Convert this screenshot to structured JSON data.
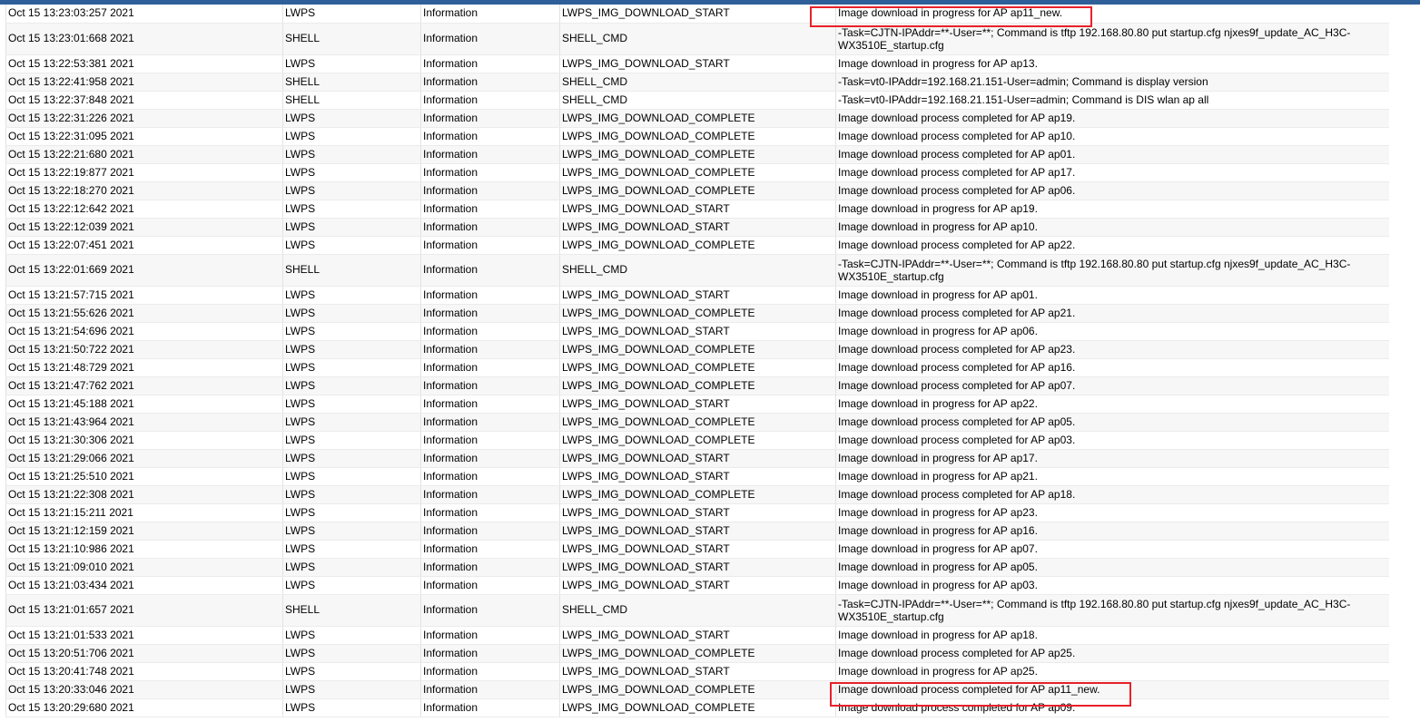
{
  "colors": {
    "top_bar": "#2f5f98",
    "highlight_border": "#e8212a",
    "row_alt": "#f7f7f7",
    "grid": "#e2e2e2"
  },
  "log": {
    "rows": [
      {
        "time": "Oct 15 13:23:03:257 2021",
        "module": "LWPS",
        "level": "Information",
        "mnemonic": "LWPS_IMG_DOWNLOAD_START",
        "message": "Image download in progress for AP ap11_new."
      },
      {
        "time": "Oct 15 13:23:01:668 2021",
        "module": "SHELL",
        "level": "Information",
        "mnemonic": "SHELL_CMD",
        "message": "-Task=CJTN-IPAddr=**-User=**; Command is tftp 192.168.80.80 put startup.cfg njxes9f_update_AC_H3C-WX3510E_startup.cfg",
        "tall": true
      },
      {
        "time": "Oct 15 13:22:53:381 2021",
        "module": "LWPS",
        "level": "Information",
        "mnemonic": "LWPS_IMG_DOWNLOAD_START",
        "message": "Image download in progress for AP ap13."
      },
      {
        "time": "Oct 15 13:22:41:958 2021",
        "module": "SHELL",
        "level": "Information",
        "mnemonic": "SHELL_CMD",
        "message": "-Task=vt0-IPAddr=192.168.21.151-User=admin; Command is display version"
      },
      {
        "time": "Oct 15 13:22:37:848 2021",
        "module": "SHELL",
        "level": "Information",
        "mnemonic": "SHELL_CMD",
        "message": "-Task=vt0-IPAddr=192.168.21.151-User=admin; Command is DIS wlan ap all"
      },
      {
        "time": "Oct 15 13:22:31:226 2021",
        "module": "LWPS",
        "level": "Information",
        "mnemonic": "LWPS_IMG_DOWNLOAD_COMPLETE",
        "message": "Image download process completed for AP ap19."
      },
      {
        "time": "Oct 15 13:22:31:095 2021",
        "module": "LWPS",
        "level": "Information",
        "mnemonic": "LWPS_IMG_DOWNLOAD_COMPLETE",
        "message": "Image download process completed for AP ap10."
      },
      {
        "time": "Oct 15 13:22:21:680 2021",
        "module": "LWPS",
        "level": "Information",
        "mnemonic": "LWPS_IMG_DOWNLOAD_COMPLETE",
        "message": "Image download process completed for AP ap01."
      },
      {
        "time": "Oct 15 13:22:19:877 2021",
        "module": "LWPS",
        "level": "Information",
        "mnemonic": "LWPS_IMG_DOWNLOAD_COMPLETE",
        "message": "Image download process completed for AP ap17."
      },
      {
        "time": "Oct 15 13:22:18:270 2021",
        "module": "LWPS",
        "level": "Information",
        "mnemonic": "LWPS_IMG_DOWNLOAD_COMPLETE",
        "message": "Image download process completed for AP ap06."
      },
      {
        "time": "Oct 15 13:22:12:642 2021",
        "module": "LWPS",
        "level": "Information",
        "mnemonic": "LWPS_IMG_DOWNLOAD_START",
        "message": "Image download in progress for AP ap19."
      },
      {
        "time": "Oct 15 13:22:12:039 2021",
        "module": "LWPS",
        "level": "Information",
        "mnemonic": "LWPS_IMG_DOWNLOAD_START",
        "message": "Image download in progress for AP ap10."
      },
      {
        "time": "Oct 15 13:22:07:451 2021",
        "module": "LWPS",
        "level": "Information",
        "mnemonic": "LWPS_IMG_DOWNLOAD_COMPLETE",
        "message": "Image download process completed for AP ap22."
      },
      {
        "time": "Oct 15 13:22:01:669 2021",
        "module": "SHELL",
        "level": "Information",
        "mnemonic": "SHELL_CMD",
        "message": "-Task=CJTN-IPAddr=**-User=**; Command is tftp 192.168.80.80 put startup.cfg njxes9f_update_AC_H3C-WX3510E_startup.cfg",
        "tall": true
      },
      {
        "time": "Oct 15 13:21:57:715 2021",
        "module": "LWPS",
        "level": "Information",
        "mnemonic": "LWPS_IMG_DOWNLOAD_START",
        "message": "Image download in progress for AP ap01."
      },
      {
        "time": "Oct 15 13:21:55:626 2021",
        "module": "LWPS",
        "level": "Information",
        "mnemonic": "LWPS_IMG_DOWNLOAD_COMPLETE",
        "message": "Image download process completed for AP ap21."
      },
      {
        "time": "Oct 15 13:21:54:696 2021",
        "module": "LWPS",
        "level": "Information",
        "mnemonic": "LWPS_IMG_DOWNLOAD_START",
        "message": "Image download in progress for AP ap06."
      },
      {
        "time": "Oct 15 13:21:50:722 2021",
        "module": "LWPS",
        "level": "Information",
        "mnemonic": "LWPS_IMG_DOWNLOAD_COMPLETE",
        "message": "Image download process completed for AP ap23."
      },
      {
        "time": "Oct 15 13:21:48:729 2021",
        "module": "LWPS",
        "level": "Information",
        "mnemonic": "LWPS_IMG_DOWNLOAD_COMPLETE",
        "message": "Image download process completed for AP ap16."
      },
      {
        "time": "Oct 15 13:21:47:762 2021",
        "module": "LWPS",
        "level": "Information",
        "mnemonic": "LWPS_IMG_DOWNLOAD_COMPLETE",
        "message": "Image download process completed for AP ap07."
      },
      {
        "time": "Oct 15 13:21:45:188 2021",
        "module": "LWPS",
        "level": "Information",
        "mnemonic": "LWPS_IMG_DOWNLOAD_START",
        "message": "Image download in progress for AP ap22."
      },
      {
        "time": "Oct 15 13:21:43:964 2021",
        "module": "LWPS",
        "level": "Information",
        "mnemonic": "LWPS_IMG_DOWNLOAD_COMPLETE",
        "message": "Image download process completed for AP ap05."
      },
      {
        "time": "Oct 15 13:21:30:306 2021",
        "module": "LWPS",
        "level": "Information",
        "mnemonic": "LWPS_IMG_DOWNLOAD_COMPLETE",
        "message": "Image download process completed for AP ap03."
      },
      {
        "time": "Oct 15 13:21:29:066 2021",
        "module": "LWPS",
        "level": "Information",
        "mnemonic": "LWPS_IMG_DOWNLOAD_START",
        "message": "Image download in progress for AP ap17."
      },
      {
        "time": "Oct 15 13:21:25:510 2021",
        "module": "LWPS",
        "level": "Information",
        "mnemonic": "LWPS_IMG_DOWNLOAD_START",
        "message": "Image download in progress for AP ap21."
      },
      {
        "time": "Oct 15 13:21:22:308 2021",
        "module": "LWPS",
        "level": "Information",
        "mnemonic": "LWPS_IMG_DOWNLOAD_COMPLETE",
        "message": "Image download process completed for AP ap18."
      },
      {
        "time": "Oct 15 13:21:15:211 2021",
        "module": "LWPS",
        "level": "Information",
        "mnemonic": "LWPS_IMG_DOWNLOAD_START",
        "message": "Image download in progress for AP ap23."
      },
      {
        "time": "Oct 15 13:21:12:159 2021",
        "module": "LWPS",
        "level": "Information",
        "mnemonic": "LWPS_IMG_DOWNLOAD_START",
        "message": "Image download in progress for AP ap16."
      },
      {
        "time": "Oct 15 13:21:10:986 2021",
        "module": "LWPS",
        "level": "Information",
        "mnemonic": "LWPS_IMG_DOWNLOAD_START",
        "message": "Image download in progress for AP ap07."
      },
      {
        "time": "Oct 15 13:21:09:010 2021",
        "module": "LWPS",
        "level": "Information",
        "mnemonic": "LWPS_IMG_DOWNLOAD_START",
        "message": "Image download in progress for AP ap05."
      },
      {
        "time": "Oct 15 13:21:03:434 2021",
        "module": "LWPS",
        "level": "Information",
        "mnemonic": "LWPS_IMG_DOWNLOAD_START",
        "message": "Image download in progress for AP ap03."
      },
      {
        "time": "Oct 15 13:21:01:657 2021",
        "module": "SHELL",
        "level": "Information",
        "mnemonic": "SHELL_CMD",
        "message": "-Task=CJTN-IPAddr=**-User=**; Command is tftp 192.168.80.80 put startup.cfg njxes9f_update_AC_H3C-WX3510E_startup.cfg",
        "tall": true
      },
      {
        "time": "Oct 15 13:21:01:533 2021",
        "module": "LWPS",
        "level": "Information",
        "mnemonic": "LWPS_IMG_DOWNLOAD_START",
        "message": "Image download in progress for AP ap18."
      },
      {
        "time": "Oct 15 13:20:51:706 2021",
        "module": "LWPS",
        "level": "Information",
        "mnemonic": "LWPS_IMG_DOWNLOAD_COMPLETE",
        "message": "Image download process completed for AP ap25."
      },
      {
        "time": "Oct 15 13:20:41:748 2021",
        "module": "LWPS",
        "level": "Information",
        "mnemonic": "LWPS_IMG_DOWNLOAD_START",
        "message": "Image download in progress for AP ap25."
      },
      {
        "time": "Oct 15 13:20:33:046 2021",
        "module": "LWPS",
        "level": "Information",
        "mnemonic": "LWPS_IMG_DOWNLOAD_COMPLETE",
        "message": "Image download process completed for AP ap11_new."
      },
      {
        "time": "Oct 15 13:20:29:680 2021",
        "module": "LWPS",
        "level": "Information",
        "mnemonic": "LWPS_IMG_DOWNLOAD_COMPLETE",
        "message": "Image download process completed for AP ap09."
      }
    ]
  }
}
